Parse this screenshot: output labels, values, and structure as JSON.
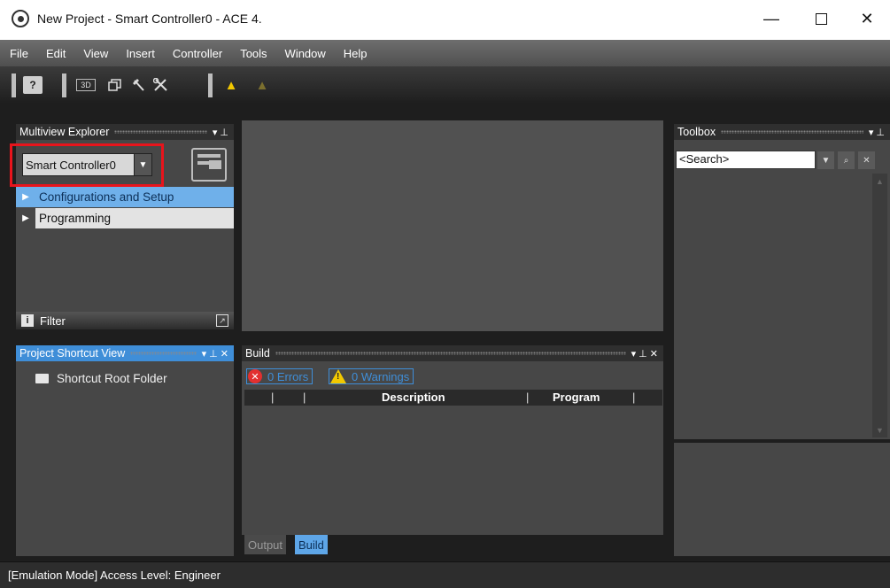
{
  "window": {
    "title": "New Project - Smart Controller0 - ACE 4.",
    "minimize": "—",
    "close": "✕"
  },
  "menu": [
    "File",
    "Edit",
    "View",
    "Insert",
    "Controller",
    "Tools",
    "Window",
    "Help"
  ],
  "toolbar": {
    "help_label": "?",
    "view3d_label": "3D",
    "icons": [
      "help-icon",
      "3d-view-icon",
      "layout-icon",
      "hammer-icon",
      "tools-icon",
      "warning-icon",
      "warning-off-icon"
    ]
  },
  "multiview_explorer": {
    "title": "Multiview Explorer",
    "controls": "▾ ⊥",
    "controller_value": "Smart Controller0",
    "items": [
      {
        "label": "Configurations and Setup",
        "selected": true
      },
      {
        "label": "Programming",
        "selected": false
      }
    ],
    "filter_label": "Filter",
    "highlight_color": "#e8141c"
  },
  "project_shortcut": {
    "title": "Project Shortcut View",
    "controls": "▾ ⊥ ✕",
    "folder_label": "Shortcut Root Folder"
  },
  "build": {
    "title": "Build",
    "controls": "▾ ⊥ ✕",
    "errors_label": "0  Errors",
    "warnings_label": "0  Warnings",
    "columns": [
      "Description",
      "Program"
    ],
    "tabs": [
      "Output",
      "Build"
    ],
    "active_tab": "Build"
  },
  "toolbox": {
    "title": "Toolbox",
    "controls": "▾ ⊥",
    "search_value": "<Search>"
  },
  "status": {
    "text": "[Emulation Mode] Access Level: Engineer"
  },
  "colors": {
    "accent": "#3f8ed8",
    "selected_row": "#6fb0ea",
    "background": "#1e1e1e",
    "panel": "#474747"
  }
}
